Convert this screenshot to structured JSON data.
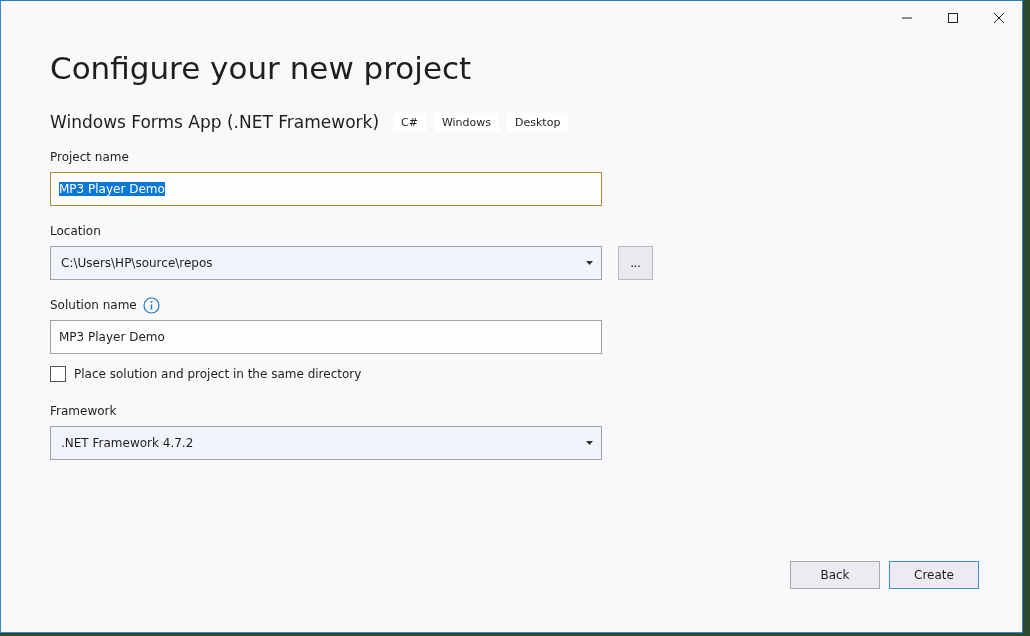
{
  "title": "Configure your new project",
  "template": {
    "name": "Windows Forms App (.NET Framework)",
    "tags": [
      "C#",
      "Windows",
      "Desktop"
    ]
  },
  "fields": [
    {
      "kind": "text",
      "label": "Project name",
      "value": "MP3 Player Demo",
      "focused": true,
      "text_selected": true
    },
    {
      "kind": "dropdown",
      "label": "Location",
      "value": "C:\\Users\\HP\\source\\repos",
      "browse_button": "..."
    },
    {
      "kind": "text",
      "label": "Solution name",
      "info": true,
      "value": "MP3 Player Demo",
      "focused": false,
      "text_selected": false
    },
    {
      "kind": "checkbox",
      "label": "Place solution and project in the same directory",
      "checked": false
    },
    {
      "kind": "dropdown",
      "label": "Framework",
      "value": ".NET Framework 4.7.2"
    }
  ],
  "buttons": [
    {
      "label": "Back",
      "default": false
    },
    {
      "label": "Create",
      "default": true
    }
  ]
}
